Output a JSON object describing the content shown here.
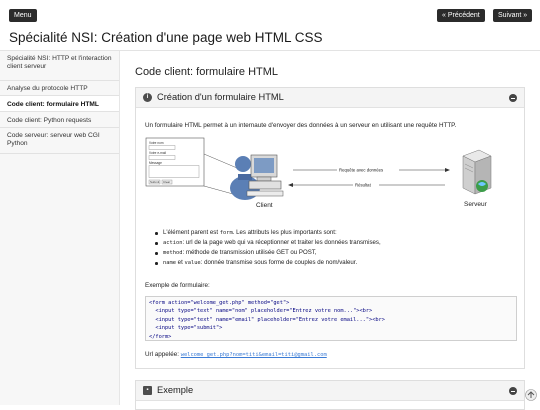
{
  "top": {
    "menu_label": "Menu",
    "prev_label": "« Précédent",
    "next_label": "Suivant »",
    "doc_title": "Spécialité NSI: Création d'une page web HTML CSS"
  },
  "sidebar": {
    "items": [
      {
        "label": "Spécialité NSI: HTTP et l'interaction client serveur",
        "active": false
      },
      {
        "label": "Analyse du protocole HTTP",
        "active": false
      },
      {
        "label": "Code client: formulaire HTML",
        "active": true
      },
      {
        "label": "Code client: Python requests",
        "active": false
      },
      {
        "label": "Code serveur: serveur web CGI Python",
        "active": false
      }
    ]
  },
  "main": {
    "heading": "Code client: formulaire HTML",
    "card1": {
      "title": "Création d'un formulaire HTML",
      "intro": "Un formulaire HTML permet à un internaute d'envoyer des données à un serveur en utilisant une requête HTTP.",
      "diagram": {
        "client_label": "Client",
        "server_label": "Serveur",
        "request_label": "Requête avec données",
        "result_label": "Résultat",
        "form_fields": [
          "Votre nom",
          "Votre e-mail",
          "Message"
        ],
        "form_buttons": [
          "Submit",
          "Clear"
        ]
      },
      "bullets": [
        {
          "pre": "L'élément parent est ",
          "code": "form",
          "post": ". Les attributs les plus importants sont:"
        },
        {
          "pre": "",
          "code": "action",
          "post": ": url de la page web qui va réceptionner et traiter les données transmises,"
        },
        {
          "pre": "",
          "code": "method",
          "post": ": méthode de transmission utilisée GET ou POST,"
        },
        {
          "pre": "",
          "code": "name",
          "post": " et ",
          "code2": "value",
          "post2": ": donnée transmise sous forme de couples de nom/valeur."
        }
      ],
      "example_label": "Exemple de formulaire:",
      "code_lines": [
        "<form action=\"welcome_get.php\" method=\"get\">",
        "  <input type=\"text\" name=\"nom\" placeholder=\"Entrez votre nom...\"><br>",
        "  <input type=\"text\" name=\"email\" placeholder=\"Entrez votre email...\"><br>",
        "  <input type=\"submit\">",
        "</form>"
      ],
      "url_label": "Url appelée: ",
      "url_value": "welcome_get.php?nom=titi&email=titi@gmail.com"
    },
    "card2": {
      "title": "Exemple"
    }
  }
}
